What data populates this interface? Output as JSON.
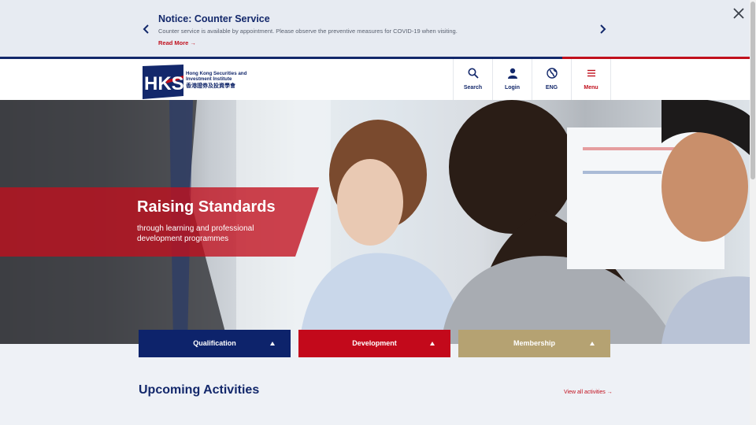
{
  "notice": {
    "title": "Notice: Counter Service",
    "text": "Counter service is available by appointment. Please observe the preventive measures for COVID-19 when visiting.",
    "read_more": "Read More →"
  },
  "header": {
    "logo_text": "HKSI",
    "logo_caption_en": "Hong Kong Securities and Investment Institute",
    "logo_caption_zh": "香港證券及投資學會",
    "nav": [
      {
        "label": "Search",
        "icon": "search-icon"
      },
      {
        "label": "Login",
        "icon": "user-icon"
      },
      {
        "label": "ENG",
        "icon": "globe-icon"
      },
      {
        "label": "Menu",
        "icon": "hamburger-icon"
      }
    ]
  },
  "hero": {
    "title": "Raising Standards",
    "subtitle": "through learning and professional development programmes"
  },
  "categories": [
    {
      "label": "Qualification",
      "color": "#0d236b"
    },
    {
      "label": "Development",
      "color": "#c3091b"
    },
    {
      "label": "Membership",
      "color": "#b5a272"
    }
  ],
  "upcoming": {
    "title": "Upcoming Activities",
    "view_all": "View all activities →"
  },
  "colors": {
    "navy": "#13286b",
    "red": "#c1101d",
    "gold": "#b5a272"
  }
}
